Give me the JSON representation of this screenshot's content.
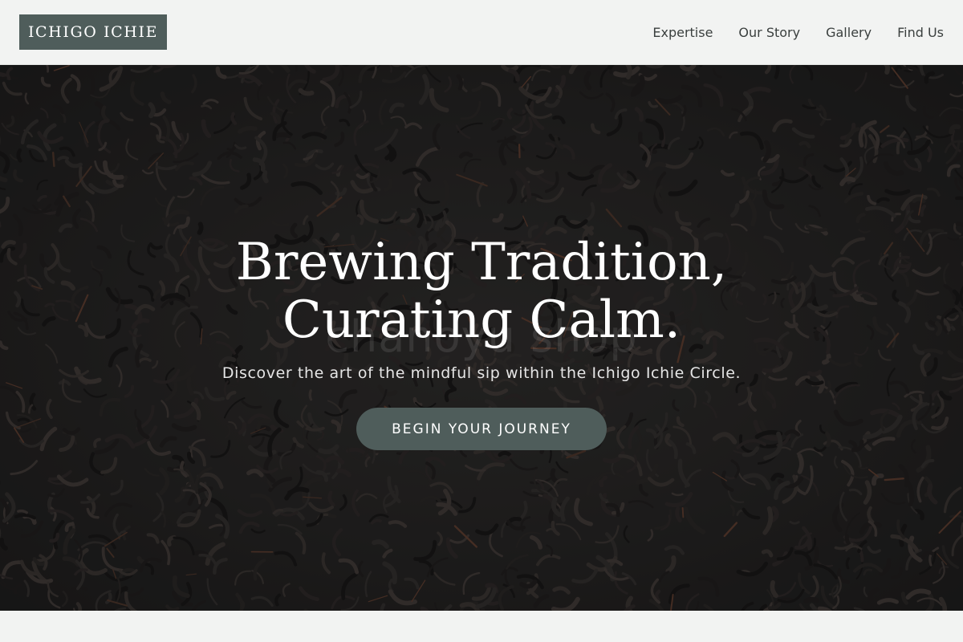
{
  "brand": {
    "logo_text": "ICHIGO ICHIE"
  },
  "nav": {
    "items": [
      {
        "label": "Expertise"
      },
      {
        "label": "Our Story"
      },
      {
        "label": "Gallery"
      },
      {
        "label": "Find Us"
      }
    ]
  },
  "hero": {
    "title": "Brewing Tradition, Curating Calm.",
    "subtitle": "Discover the art of the mindful sip within the Ichigo Ichie Circle.",
    "cta_label": "BEGIN YOUR JOURNEY",
    "watermark_text": "chanoyu shop",
    "background_image": "dark-tea-leaves"
  },
  "colors": {
    "accent": "#4f5d5b",
    "page_background": "#f2f3f2",
    "hero_dark": "#232121",
    "text_light": "#ffffff"
  }
}
